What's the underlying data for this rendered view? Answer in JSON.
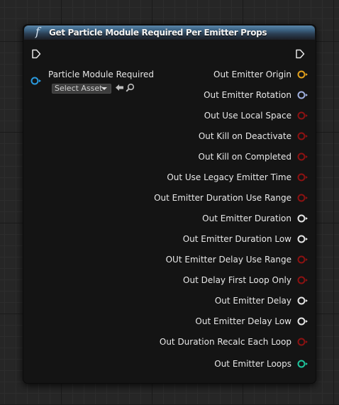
{
  "node": {
    "title": "Get Particle Module Required Per Emitter Props",
    "function_icon": "f",
    "input": {
      "label": "Particle Module Required",
      "asset_placeholder": "Select Asset",
      "pin_color": "#2a9be0"
    },
    "outputs": [
      {
        "label": "Out Emitter Origin",
        "pin_color": "#e2a11c",
        "connected": false
      },
      {
        "label": "Out Emitter Rotation",
        "pin_color": "#9fb0e0",
        "connected": false
      },
      {
        "label": "Out Use Local Space",
        "pin_color": "#8d1212",
        "connected": false
      },
      {
        "label": "Out Kill on Deactivate",
        "pin_color": "#8d1212",
        "connected": false
      },
      {
        "label": "Out Kill on Completed",
        "pin_color": "#8d1212",
        "connected": false
      },
      {
        "label": "Out Use Legacy Emitter Time",
        "pin_color": "#8d1212",
        "connected": false
      },
      {
        "label": "Out Emitter Duration Use Range",
        "pin_color": "#8d1212",
        "connected": false
      },
      {
        "label": "Out Emitter Duration",
        "pin_color": "#e6e6e6",
        "connected": false
      },
      {
        "label": "Out Emitter Duration Low",
        "pin_color": "#e6e6e6",
        "connected": false
      },
      {
        "label": "OUt Emitter Delay Use Range",
        "pin_color": "#8d1212",
        "connected": false
      },
      {
        "label": "Out Delay First Loop Only",
        "pin_color": "#8d1212",
        "connected": false
      },
      {
        "label": "Out Emitter Delay",
        "pin_color": "#e6e6e6",
        "connected": false
      },
      {
        "label": "Out Emitter Delay Low",
        "pin_color": "#e6e6e6",
        "connected": false
      },
      {
        "label": "Out Duration Recalc Each Loop",
        "pin_color": "#8d1212",
        "connected": false
      },
      {
        "label": "Out Emitter Loops",
        "pin_color": "#1fc79e",
        "connected": false
      }
    ]
  }
}
